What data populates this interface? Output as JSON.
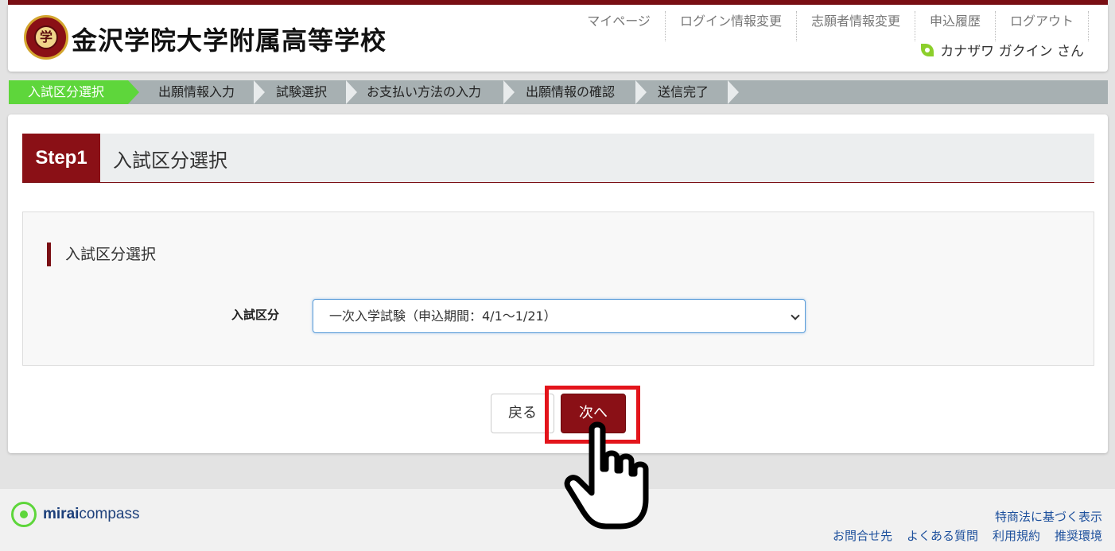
{
  "header": {
    "school_name": "金沢学院大学附属高等学校",
    "logo_char": "学",
    "nav": [
      "マイページ",
      "ログイン情報変更",
      "志願者情報変更",
      "申込履歴",
      "ログアウト"
    ],
    "user_name": "カナザワ ガクイン さん"
  },
  "steps": [
    "入試区分選択",
    "出願情報入力",
    "試験選択",
    "お支払い方法の入力",
    "出願情報の確認",
    "送信完了"
  ],
  "main": {
    "step_badge": "Step1",
    "step_title": "入試区分選択",
    "section_title": "入試区分選択",
    "field_label": "入試区分",
    "select_value": "一次入学試験（申込期間：4/1〜1/21）",
    "back_label": "戻る",
    "next_label": "次へ"
  },
  "footer": {
    "brand_bold": "mirai",
    "brand_rest": "compass",
    "link_top": "特商法に基づく表示",
    "links": [
      "お問合せ先",
      "よくある質問",
      "利用規約",
      "推奨環境"
    ]
  },
  "colors": {
    "brand": "#8a1016",
    "active_step": "#5ed63b",
    "highlight": "#e3141b"
  }
}
